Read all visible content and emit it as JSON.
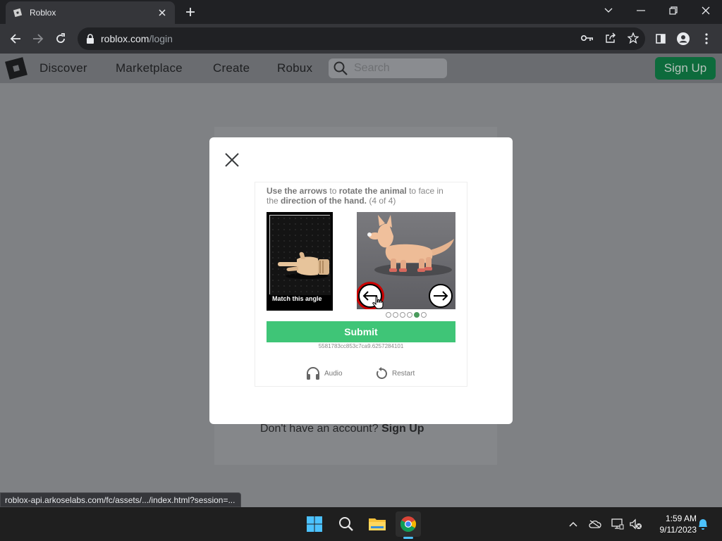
{
  "browser": {
    "tab": {
      "title": "Roblox"
    },
    "address": {
      "host": "roblox.com",
      "path": "/login"
    },
    "status_url": "roblox-api.arkoselabs.com/fc/assets/.../index.html?session=..."
  },
  "roblox_nav": {
    "links": [
      "Discover",
      "Marketplace",
      "Create",
      "Robux"
    ],
    "search_placeholder": "Search",
    "signup_label": "Sign Up"
  },
  "login_page": {
    "no_account_text": "Don't have an account?",
    "signup_link": "Sign Up"
  },
  "captcha": {
    "instruction": {
      "p1": "Use the arrows",
      "p2": " to ",
      "p3": "rotate the animal",
      "p4": " to face in the ",
      "p5": "direction of the hand.",
      "p6": " (4 of 4)"
    },
    "hand_label": "Match this angle",
    "progress": {
      "total": 6,
      "current": 5
    },
    "submit_label": "Submit",
    "session_id": "5581783cc853c7ca9.6257284101",
    "audio_label": "Audio",
    "restart_label": "Restart"
  },
  "taskbar": {
    "time": "1:59 AM",
    "date": "9/11/2023"
  },
  "colors": {
    "submit_green": "#3fc577",
    "signup_green": "#0d6b3c",
    "page_overlay": "#7f8184"
  }
}
